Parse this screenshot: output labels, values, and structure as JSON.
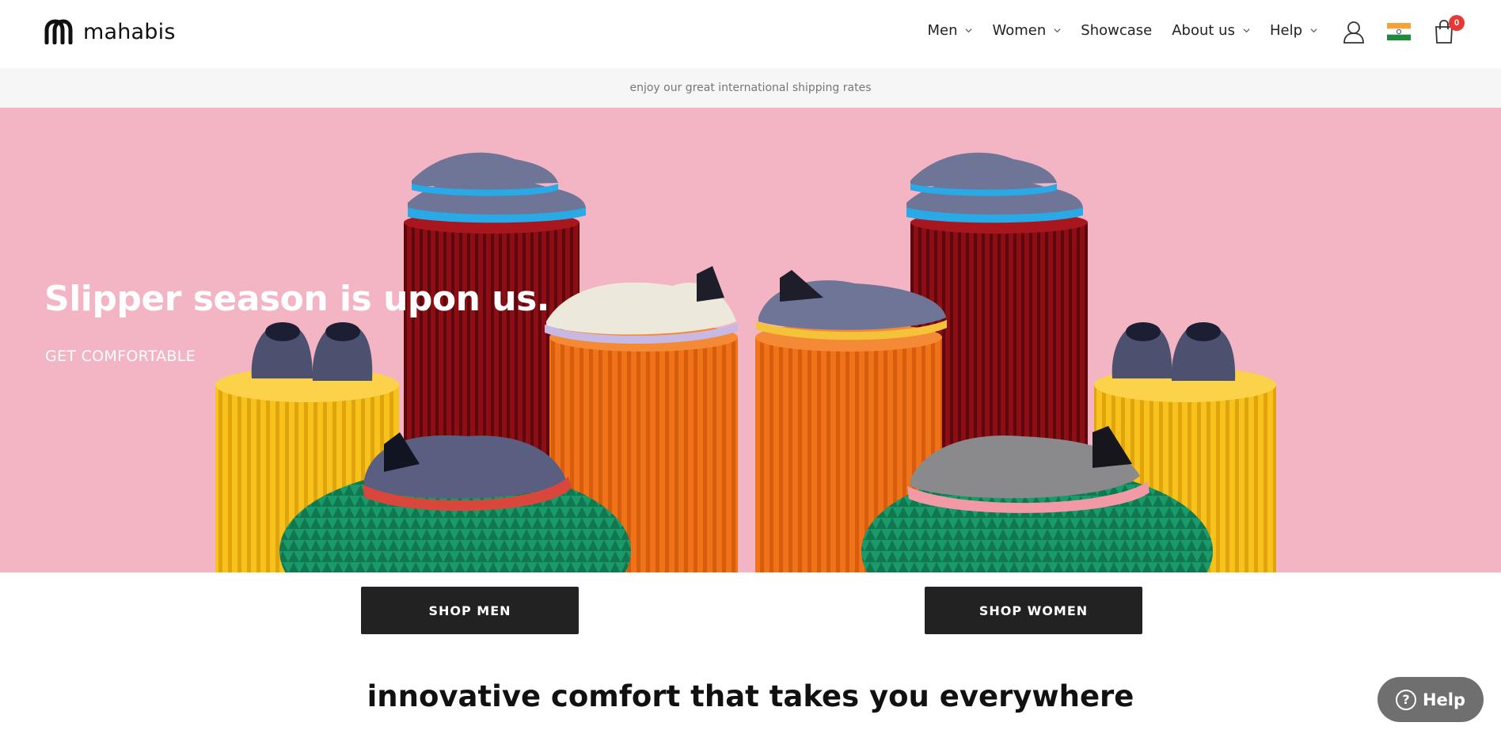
{
  "header": {
    "logo_text": "mahabis",
    "nav": [
      {
        "label": "Men",
        "has_dropdown": true
      },
      {
        "label": "Women",
        "has_dropdown": true
      },
      {
        "label": "Showcase",
        "has_dropdown": false
      },
      {
        "label": "About us",
        "has_dropdown": true
      },
      {
        "label": "Help",
        "has_dropdown": true
      }
    ],
    "icons": [
      "account-icon",
      "india-flag-icon",
      "cart-icon"
    ],
    "cart_count": "0"
  },
  "announcement": "enjoy our great international shipping rates",
  "hero": {
    "title": "Slipper season is upon us.",
    "subtitle": "GET COMFORTABLE"
  },
  "buttons": {
    "shop_men": "SHOP MEN",
    "shop_women": "SHOP WOMEN"
  },
  "tagline": "innovative comfort that takes you everywhere",
  "help_widget": {
    "label": "Help",
    "icon": "?"
  },
  "colors": {
    "hero_bg": "#f3b4c4",
    "button_bg": "#222222",
    "badge": "#e53935",
    "announce_bg": "#f6f6f6"
  }
}
